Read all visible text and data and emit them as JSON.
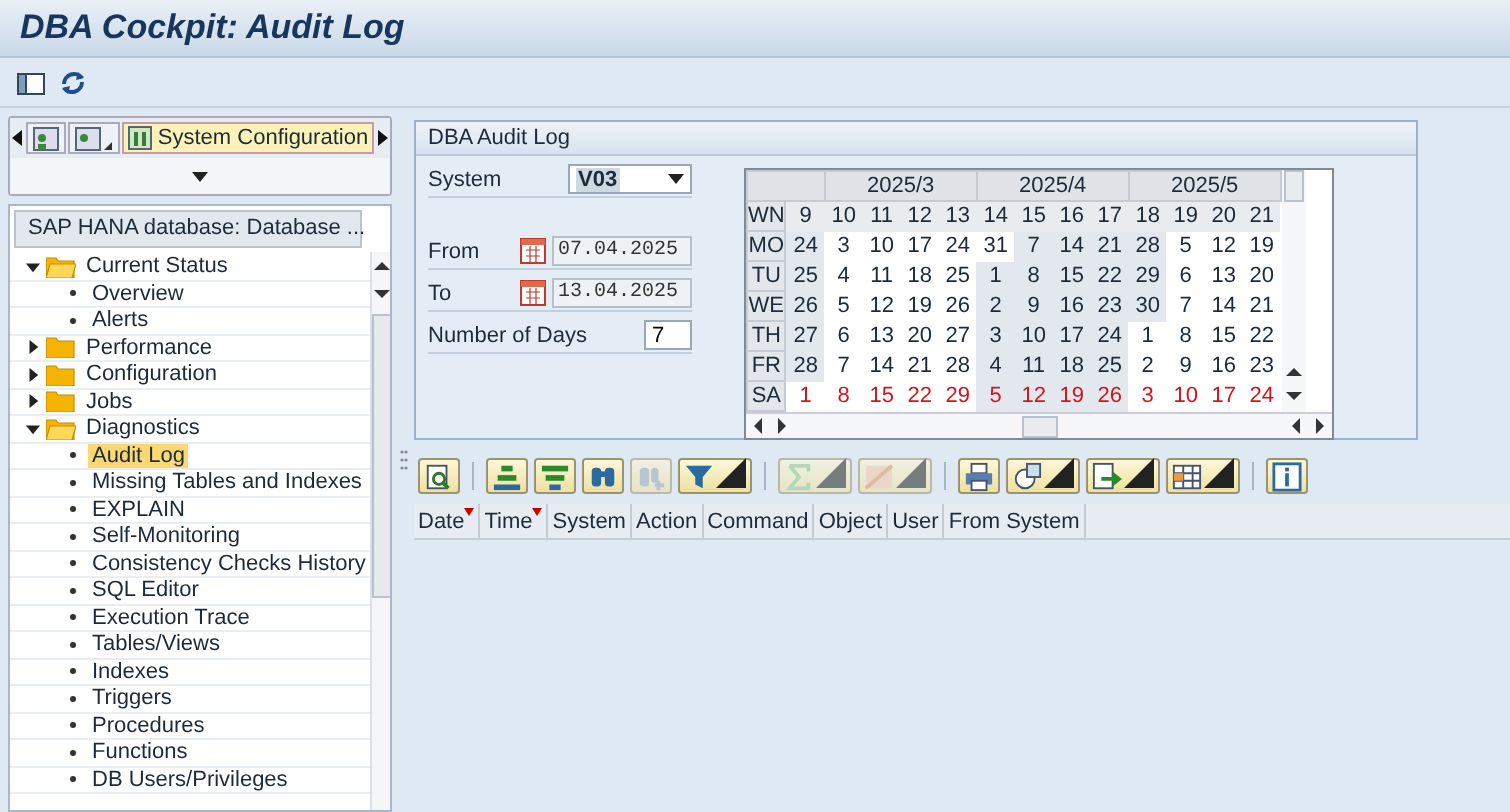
{
  "window": {
    "title": "DBA Cockpit: Audit Log"
  },
  "app_toolbar": [
    {
      "kind": "panel"
    },
    {
      "kind": "refresh"
    }
  ],
  "nav_tabs": [
    {
      "kind": "scroll-left"
    },
    {
      "kind": "icon",
      "selected": false
    },
    {
      "kind": "icon-menu",
      "selected": false
    },
    {
      "kind": "text",
      "label": "System Configuration",
      "selected": true
    },
    {
      "kind": "scroll-right"
    }
  ],
  "tree": {
    "title": "SAP HANA database: Database ...",
    "items": [
      {
        "label": "Current Status",
        "expanded": true,
        "children": [
          {
            "label": "Overview",
            "selected": false
          },
          {
            "label": "Alerts",
            "selected": false
          }
        ]
      },
      {
        "label": "Performance",
        "expanded": false
      },
      {
        "label": "Configuration",
        "expanded": false
      },
      {
        "label": "Jobs",
        "expanded": false
      },
      {
        "label": "Diagnostics",
        "expanded": true,
        "children": [
          {
            "label": "Audit Log",
            "selected": true
          },
          {
            "label": "Missing Tables and Indexes",
            "selected": false
          },
          {
            "label": "EXPLAIN",
            "selected": false
          },
          {
            "label": "Self-Monitoring",
            "selected": false
          },
          {
            "label": "Consistency Checks History",
            "selected": false
          },
          {
            "label": "SQL Editor",
            "selected": false
          },
          {
            "label": "Execution Trace",
            "selected": false
          },
          {
            "label": "Tables/Views",
            "selected": false
          },
          {
            "label": "Indexes",
            "selected": false
          },
          {
            "label": "Triggers",
            "selected": false
          },
          {
            "label": "Procedures",
            "selected": false
          },
          {
            "label": "Functions",
            "selected": false
          },
          {
            "label": "DB Users/Privileges",
            "selected": false
          }
        ]
      }
    ]
  },
  "audit_panel": {
    "title": "DBA Audit Log",
    "fields": [
      {
        "kind": "dropdown",
        "label": "System",
        "value": "V03"
      },
      {
        "kind": "date",
        "label": "From",
        "value": "07.04.2025"
      },
      {
        "kind": "date",
        "label": "To",
        "value": "13.04.2025"
      },
      {
        "kind": "number",
        "label": "Number of Days",
        "value": "7"
      }
    ],
    "calendar": {
      "months": [
        {
          "label": "2025/3"
        },
        {
          "label": "2025/4"
        },
        {
          "label": "2025/5"
        }
      ],
      "corner": "WN",
      "weeks": [
        "9",
        "10",
        "11",
        "12",
        "13",
        "14",
        "15",
        "16",
        "17",
        "18",
        "19",
        "20",
        "21"
      ],
      "rows": [
        {
          "day": "MO",
          "weekend": false,
          "cells": [
            {
              "d": "24",
              "shaded": true
            },
            {
              "d": "3",
              "shaded": false
            },
            {
              "d": "10",
              "shaded": false
            },
            {
              "d": "17",
              "shaded": false
            },
            {
              "d": "24",
              "shaded": false
            },
            {
              "d": "31",
              "shaded": false
            },
            {
              "d": "7",
              "shaded": true
            },
            {
              "d": "14",
              "shaded": true
            },
            {
              "d": "21",
              "shaded": true
            },
            {
              "d": "28",
              "shaded": true
            },
            {
              "d": "5",
              "shaded": false
            },
            {
              "d": "12",
              "shaded": false
            },
            {
              "d": "19",
              "shaded": false
            }
          ]
        },
        {
          "day": "TU",
          "weekend": false,
          "cells": [
            {
              "d": "25",
              "shaded": true
            },
            {
              "d": "4",
              "shaded": false
            },
            {
              "d": "11",
              "shaded": false
            },
            {
              "d": "18",
              "shaded": false
            },
            {
              "d": "25",
              "shaded": false
            },
            {
              "d": "1",
              "shaded": true
            },
            {
              "d": "8",
              "shaded": true
            },
            {
              "d": "15",
              "shaded": true
            },
            {
              "d": "22",
              "shaded": true
            },
            {
              "d": "29",
              "shaded": true
            },
            {
              "d": "6",
              "shaded": false
            },
            {
              "d": "13",
              "shaded": false
            },
            {
              "d": "20",
              "shaded": false
            }
          ]
        },
        {
          "day": "WE",
          "weekend": false,
          "cells": [
            {
              "d": "26",
              "shaded": true
            },
            {
              "d": "5",
              "shaded": false
            },
            {
              "d": "12",
              "shaded": false
            },
            {
              "d": "19",
              "shaded": false
            },
            {
              "d": "26",
              "shaded": false
            },
            {
              "d": "2",
              "shaded": true
            },
            {
              "d": "9",
              "shaded": true
            },
            {
              "d": "16",
              "shaded": true
            },
            {
              "d": "23",
              "shaded": true
            },
            {
              "d": "30",
              "shaded": true
            },
            {
              "d": "7",
              "shaded": false
            },
            {
              "d": "14",
              "shaded": false
            },
            {
              "d": "21",
              "shaded": false
            }
          ]
        },
        {
          "day": "TH",
          "weekend": false,
          "cells": [
            {
              "d": "27",
              "shaded": true
            },
            {
              "d": "6",
              "shaded": false
            },
            {
              "d": "13",
              "shaded": false
            },
            {
              "d": "20",
              "shaded": false
            },
            {
              "d": "27",
              "shaded": false
            },
            {
              "d": "3",
              "shaded": true
            },
            {
              "d": "10",
              "shaded": true
            },
            {
              "d": "17",
              "shaded": true
            },
            {
              "d": "24",
              "shaded": true
            },
            {
              "d": "1",
              "shaded": false
            },
            {
              "d": "8",
              "shaded": false
            },
            {
              "d": "15",
              "shaded": false
            },
            {
              "d": "22",
              "shaded": false
            }
          ]
        },
        {
          "day": "FR",
          "weekend": false,
          "cells": [
            {
              "d": "28",
              "shaded": true
            },
            {
              "d": "7",
              "shaded": false
            },
            {
              "d": "14",
              "shaded": false
            },
            {
              "d": "21",
              "shaded": false
            },
            {
              "d": "28",
              "shaded": false
            },
            {
              "d": "4",
              "shaded": true
            },
            {
              "d": "11",
              "shaded": true
            },
            {
              "d": "18",
              "shaded": true
            },
            {
              "d": "25",
              "shaded": true
            },
            {
              "d": "2",
              "shaded": false
            },
            {
              "d": "9",
              "shaded": false
            },
            {
              "d": "16",
              "shaded": false
            },
            {
              "d": "23",
              "shaded": false
            }
          ]
        },
        {
          "day": "SA",
          "weekend": true,
          "cells": [
            {
              "d": "1",
              "shaded": false
            },
            {
              "d": "8",
              "shaded": false
            },
            {
              "d": "15",
              "shaded": false
            },
            {
              "d": "22",
              "shaded": false
            },
            {
              "d": "29",
              "shaded": false
            },
            {
              "d": "5",
              "shaded": true
            },
            {
              "d": "12",
              "shaded": true
            },
            {
              "d": "19",
              "shaded": true
            },
            {
              "d": "26",
              "shaded": true
            },
            {
              "d": "3",
              "shaded": false
            },
            {
              "d": "10",
              "shaded": false
            },
            {
              "d": "17",
              "shaded": false
            },
            {
              "d": "24",
              "shaded": false
            }
          ]
        }
      ]
    }
  },
  "grid_toolbar": [
    [
      {
        "kind": "details",
        "menu": false,
        "disabled": false
      }
    ],
    [
      {
        "kind": "sort-up",
        "menu": false,
        "disabled": false
      },
      {
        "kind": "sort-down",
        "menu": false,
        "disabled": false
      },
      {
        "kind": "find",
        "menu": false,
        "disabled": false
      },
      {
        "kind": "find-next",
        "menu": false,
        "disabled": true
      },
      {
        "kind": "filter",
        "menu": true,
        "disabled": false
      }
    ],
    [
      {
        "kind": "sum",
        "menu": true,
        "disabled": true
      },
      {
        "kind": "subtotal",
        "menu": true,
        "disabled": true
      }
    ],
    [
      {
        "kind": "print",
        "menu": false,
        "disabled": false
      },
      {
        "kind": "views",
        "menu": true,
        "disabled": false
      },
      {
        "kind": "export",
        "menu": true,
        "disabled": false
      },
      {
        "kind": "layout",
        "menu": true,
        "disabled": false
      }
    ],
    [
      {
        "kind": "info",
        "menu": false,
        "disabled": false
      }
    ]
  ],
  "table": {
    "columns": [
      {
        "label": "Date",
        "sorted": true
      },
      {
        "label": "Time",
        "sorted": true
      },
      {
        "label": "System",
        "sorted": false
      },
      {
        "label": "Action",
        "sorted": false
      },
      {
        "label": "Command",
        "sorted": false
      },
      {
        "label": "Object",
        "sorted": false
      },
      {
        "label": "User",
        "sorted": false
      },
      {
        "label": "From System",
        "sorted": false
      }
    ]
  }
}
